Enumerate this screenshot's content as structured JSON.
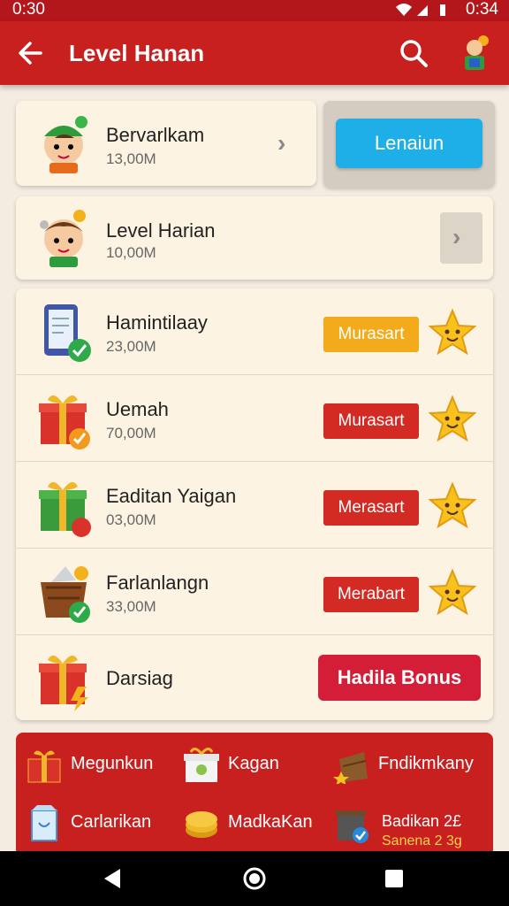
{
  "status_bar": {
    "time_left": "0:30",
    "time_right": "0:34"
  },
  "app_bar": {
    "title": "Level Hanan"
  },
  "top_card": {
    "name": "Bervarlkam",
    "sub": "13,00M",
    "button": "Lenaiun"
  },
  "second_card": {
    "name": "Level Harian",
    "sub": "10,00M"
  },
  "rows": [
    {
      "name": "Hamintilaay",
      "sub": "23,00M",
      "button": "Murasart",
      "button_color": "#f3aa1b"
    },
    {
      "name": "Uemah",
      "sub": "70,00M",
      "button": "Murasart",
      "button_color": "#d32a24"
    },
    {
      "name": "Eaditan Yaigan",
      "sub": "03,00M",
      "button": "Merasart",
      "button_color": "#d32a24"
    },
    {
      "name": "Farlanlangn",
      "sub": "33,00M",
      "button": "Merabart",
      "button_color": "#d32a24"
    }
  ],
  "bonus_row": {
    "name": "Darsiag",
    "button": "Hadila Bonus"
  },
  "bottom_panel": {
    "items": [
      {
        "label": "Megunkun"
      },
      {
        "label": "Kagan"
      },
      {
        "label": "Fndikmkany"
      },
      {
        "label": "Carlarikan"
      },
      {
        "label": "MadkaKan"
      },
      {
        "label": "Badikan 2£"
      }
    ],
    "extra": "Sanena 2 3g"
  },
  "icons": {
    "back": "arrow-left-icon",
    "search": "search-icon",
    "avatar": "avatar-icon",
    "chevron": "chevron-right-icon",
    "star": "star-icon",
    "nav_back": "triangle-back-icon",
    "nav_home": "circle-home-icon",
    "nav_recent": "square-recent-icon"
  }
}
